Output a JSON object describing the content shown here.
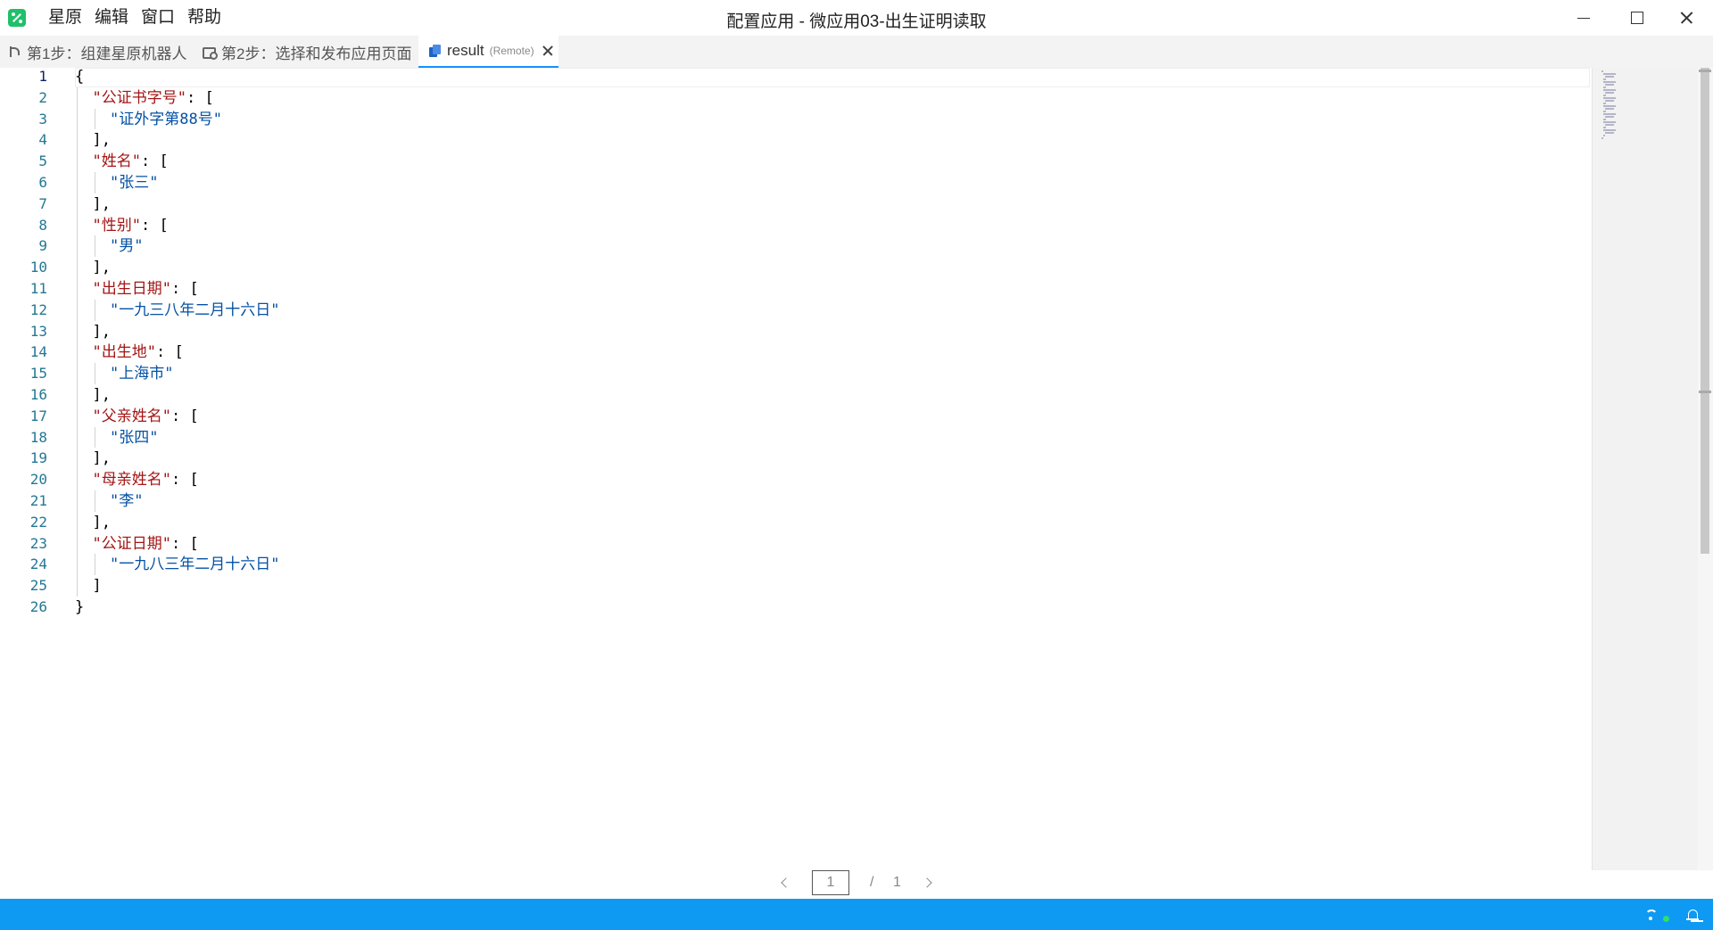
{
  "app": {
    "menu": [
      "星原",
      "编辑",
      "窗口",
      "帮助"
    ],
    "window_title": "配置应用 - 微应用03-出生证明读取"
  },
  "tabs": [
    {
      "label": "第1步：组建星原机器人",
      "icon": "branch-icon"
    },
    {
      "label": "第2步：选择和发布应用页面",
      "icon": "page-icon"
    },
    {
      "label": "result",
      "tag": "(Remote)",
      "icon": "document-icon",
      "active": true
    }
  ],
  "editor": {
    "fields": [
      {
        "key": "\"公证书字号\"",
        "value": "\"证外字第88号\""
      },
      {
        "key": "\"姓名\"",
        "value": "\"张三\""
      },
      {
        "key": "\"性别\"",
        "value": "\"男\""
      },
      {
        "key": "\"出生日期\"",
        "value": "\"一九三八年二月十六日\""
      },
      {
        "key": "\"出生地\"",
        "value": "\"上海市\""
      },
      {
        "key": "\"父亲姓名\"",
        "value": "\"张四\""
      },
      {
        "key": "\"母亲姓名\"",
        "value": "\"李\""
      },
      {
        "key": "\"公证日期\"",
        "value": "\"一九八三年二月十六日\""
      }
    ]
  },
  "pagination": {
    "current": "1",
    "separator": "/",
    "total": "1"
  },
  "colors": {
    "accent": "#1890ff",
    "statusbar": "#0e9af2",
    "json_key": "#a31515",
    "json_string": "#0451a5",
    "line_number": "#237893"
  }
}
